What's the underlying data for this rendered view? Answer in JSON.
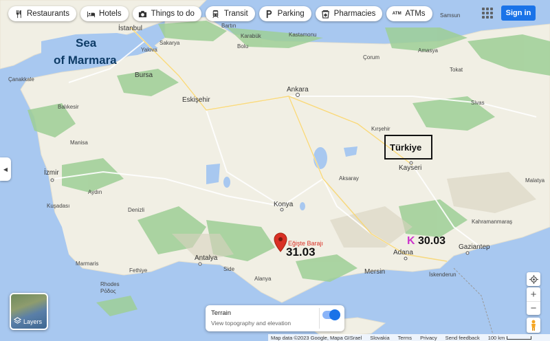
{
  "toolbar": {
    "chips": [
      {
        "label": "Restaurants",
        "icon": "fork-knife-icon"
      },
      {
        "label": "Hotels",
        "icon": "bed-icon"
      },
      {
        "label": "Things to do",
        "icon": "camera-icon"
      },
      {
        "label": "Transit",
        "icon": "train-icon"
      },
      {
        "label": "Parking",
        "icon": "parking-icon"
      },
      {
        "label": "Pharmacies",
        "icon": "pharmacy-icon"
      },
      {
        "label": "ATMs",
        "icon": "atm-icon",
        "icon_text": "ATM"
      }
    ],
    "sign_in_label": "Sign in"
  },
  "map": {
    "cities": [
      {
        "name": "Samsun"
      },
      {
        "name": "İstanbul"
      },
      {
        "name": "Bartın"
      },
      {
        "name": "Karabük"
      },
      {
        "name": "Bolu"
      },
      {
        "name": "Kastamonu"
      },
      {
        "name": "Amasya"
      },
      {
        "name": "Çorum"
      },
      {
        "name": "Yalova"
      },
      {
        "name": "Sakarya"
      },
      {
        "name": "Bursa"
      },
      {
        "name": "Tokat"
      },
      {
        "name": "Çanakkale"
      },
      {
        "name": "Ankara"
      },
      {
        "name": "Eskişehir"
      },
      {
        "name": "Sivas"
      },
      {
        "name": "Balıkesir"
      },
      {
        "name": "Kırşehir"
      },
      {
        "name": "Kayseri"
      },
      {
        "name": "İzmir"
      },
      {
        "name": "Aksaray"
      },
      {
        "name": "Malatya"
      },
      {
        "name": "Kuşadası"
      },
      {
        "name": "Konya"
      },
      {
        "name": "Denizli"
      },
      {
        "name": "Kahramanmaraş"
      },
      {
        "name": "Gaziantep"
      },
      {
        "name": "Adana"
      },
      {
        "name": "Marmaris"
      },
      {
        "name": "Antalya"
      },
      {
        "name": "Fethiye"
      },
      {
        "name": "Mersin"
      },
      {
        "name": "Side"
      },
      {
        "name": "Alanya"
      },
      {
        "name": "İskenderun"
      },
      {
        "name": "Rhodes"
      },
      {
        "name": "Ρόδος"
      },
      {
        "name": "Manisa"
      },
      {
        "name": "Aydın"
      }
    ],
    "annotations": {
      "sea_line1": "Sea",
      "sea_line2": "of Marmara",
      "country_label": "Türkiye",
      "value_west": "31.03",
      "value_east": "30.03",
      "marker_letter": "K"
    },
    "pin": {
      "label": "Eğişte Barajı",
      "color": "#d93025"
    }
  },
  "layers_label": "Layers",
  "terrain": {
    "title": "Terrain",
    "subtitle": "View topography and elevation",
    "enabled": true
  },
  "footer": {
    "map_data": "Map data ©2023 Google, Mapa GISrael",
    "region": "Slovakia",
    "terms": "Terms",
    "privacy": "Privacy",
    "feedback": "Send feedback",
    "scale": "100 km"
  },
  "colors": {
    "water": "#a8c8f0",
    "land": "#f1efe4",
    "forest": "#9ecf96",
    "accent": "#1a73e8",
    "pin": "#d93025",
    "marker_letter": "#cc33cc"
  }
}
